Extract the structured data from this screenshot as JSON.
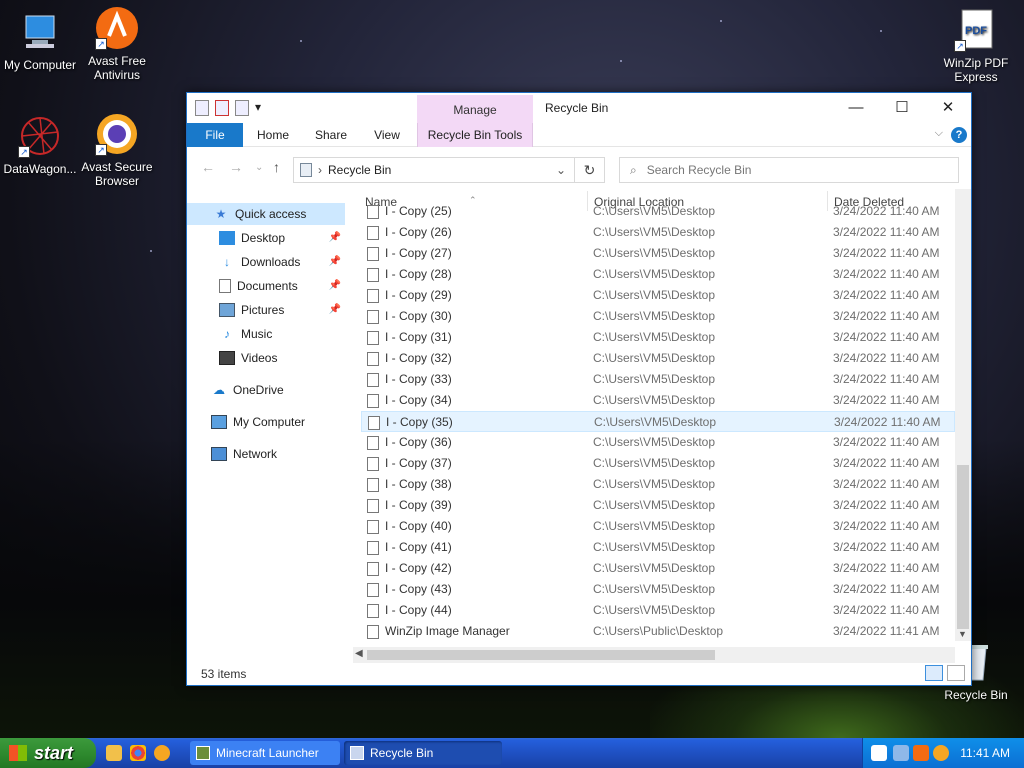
{
  "desktop": {
    "icons_left": [
      {
        "label": "My Computer",
        "icon": "monitor-icon"
      },
      {
        "label": "Avast Free Antivirus",
        "icon": "avast-icon"
      },
      {
        "label": "DataWagon...",
        "icon": "datawagon-icon"
      },
      {
        "label": "Avast Secure Browser",
        "icon": "avast-browser-icon"
      }
    ],
    "icons_right": [
      {
        "label": "WinZip PDF Express",
        "icon": "pdf-icon"
      },
      {
        "label": "Recycle Bin",
        "icon": "recycle-bin-icon"
      }
    ]
  },
  "window": {
    "title": "Recycle Bin",
    "manage_label": "Manage",
    "ribbon_tabs": [
      "File",
      "Home",
      "Share",
      "View",
      "Recycle Bin Tools"
    ],
    "address": "Recycle Bin",
    "search_placeholder": "Search Recycle Bin",
    "nav": [
      {
        "label": "Quick access",
        "icon": "star-icon",
        "selected": true,
        "pinned": false
      },
      {
        "label": "Desktop",
        "icon": "desktop-folder-icon",
        "pinned": true
      },
      {
        "label": "Downloads",
        "icon": "downloads-icon",
        "pinned": true
      },
      {
        "label": "Documents",
        "icon": "documents-icon",
        "pinned": true
      },
      {
        "label": "Pictures",
        "icon": "pictures-icon",
        "pinned": true
      },
      {
        "label": "Music",
        "icon": "music-icon",
        "pinned": false
      },
      {
        "label": "Videos",
        "icon": "videos-icon",
        "pinned": false
      },
      {
        "label": "OneDrive",
        "icon": "onedrive-icon",
        "pinned": false
      },
      {
        "label": "My Computer",
        "icon": "computer-icon",
        "pinned": false
      },
      {
        "label": "Network",
        "icon": "network-icon",
        "pinned": false
      }
    ],
    "columns": {
      "name": "Name",
      "location": "Original Location",
      "date": "Date Deleted"
    },
    "rows": [
      {
        "name": "I - Copy (25)",
        "location": "C:\\Users\\VM5\\Desktop",
        "date": "3/24/2022 11:40 AM"
      },
      {
        "name": "I - Copy (26)",
        "location": "C:\\Users\\VM5\\Desktop",
        "date": "3/24/2022 11:40 AM"
      },
      {
        "name": "I - Copy (27)",
        "location": "C:\\Users\\VM5\\Desktop",
        "date": "3/24/2022 11:40 AM"
      },
      {
        "name": "I - Copy (28)",
        "location": "C:\\Users\\VM5\\Desktop",
        "date": "3/24/2022 11:40 AM"
      },
      {
        "name": "I - Copy (29)",
        "location": "C:\\Users\\VM5\\Desktop",
        "date": "3/24/2022 11:40 AM"
      },
      {
        "name": "I - Copy (30)",
        "location": "C:\\Users\\VM5\\Desktop",
        "date": "3/24/2022 11:40 AM"
      },
      {
        "name": "I - Copy (31)",
        "location": "C:\\Users\\VM5\\Desktop",
        "date": "3/24/2022 11:40 AM"
      },
      {
        "name": "I - Copy (32)",
        "location": "C:\\Users\\VM5\\Desktop",
        "date": "3/24/2022 11:40 AM"
      },
      {
        "name": "I - Copy (33)",
        "location": "C:\\Users\\VM5\\Desktop",
        "date": "3/24/2022 11:40 AM"
      },
      {
        "name": "I - Copy (34)",
        "location": "C:\\Users\\VM5\\Desktop",
        "date": "3/24/2022 11:40 AM"
      },
      {
        "name": "I - Copy (35)",
        "location": "C:\\Users\\VM5\\Desktop",
        "date": "3/24/2022 11:40 AM",
        "selected": true
      },
      {
        "name": "I - Copy (36)",
        "location": "C:\\Users\\VM5\\Desktop",
        "date": "3/24/2022 11:40 AM"
      },
      {
        "name": "I - Copy (37)",
        "location": "C:\\Users\\VM5\\Desktop",
        "date": "3/24/2022 11:40 AM"
      },
      {
        "name": "I - Copy (38)",
        "location": "C:\\Users\\VM5\\Desktop",
        "date": "3/24/2022 11:40 AM"
      },
      {
        "name": "I - Copy (39)",
        "location": "C:\\Users\\VM5\\Desktop",
        "date": "3/24/2022 11:40 AM"
      },
      {
        "name": "I - Copy (40)",
        "location": "C:\\Users\\VM5\\Desktop",
        "date": "3/24/2022 11:40 AM"
      },
      {
        "name": "I - Copy (41)",
        "location": "C:\\Users\\VM5\\Desktop",
        "date": "3/24/2022 11:40 AM"
      },
      {
        "name": "I - Copy (42)",
        "location": "C:\\Users\\VM5\\Desktop",
        "date": "3/24/2022 11:40 AM"
      },
      {
        "name": "I - Copy (43)",
        "location": "C:\\Users\\VM5\\Desktop",
        "date": "3/24/2022 11:40 AM"
      },
      {
        "name": "I - Copy (44)",
        "location": "C:\\Users\\VM5\\Desktop",
        "date": "3/24/2022 11:40 AM"
      },
      {
        "name": "WinZip Image Manager",
        "location": "C:\\Users\\Public\\Desktop",
        "date": "3/24/2022 11:41 AM"
      }
    ],
    "status": "53 items"
  },
  "taskbar": {
    "start_label": "start",
    "buttons": [
      {
        "label": "Minecraft Launcher",
        "icon": "minecraft-icon"
      },
      {
        "label": "Recycle Bin",
        "icon": "recycle-bin-icon",
        "active": true
      }
    ],
    "clock": "11:41 AM"
  },
  "colors": {
    "accent": "#1979ca",
    "manage_tab": "#f3d9f6",
    "selection": "#cde8ff",
    "taskbar": "#245edb",
    "start": "#2f8b2f"
  }
}
